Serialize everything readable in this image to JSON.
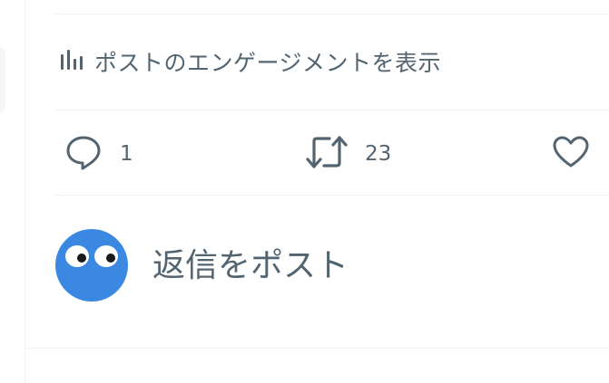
{
  "post": {
    "engagement_link": "ポストのエンゲージメントを表示",
    "actions": {
      "reply_count": "1",
      "repost_count": "23",
      "like_count": ""
    }
  },
  "composer": {
    "placeholder": "返信をポスト"
  },
  "icons": {
    "engagement": "bar-chart-icon",
    "reply": "speech-bubble-icon",
    "repost": "repost-arrows-icon",
    "like": "heart-icon"
  },
  "colors": {
    "icon_gray": "#536471",
    "divider": "#eff3f4",
    "avatar_bg": "#3b88e3"
  }
}
